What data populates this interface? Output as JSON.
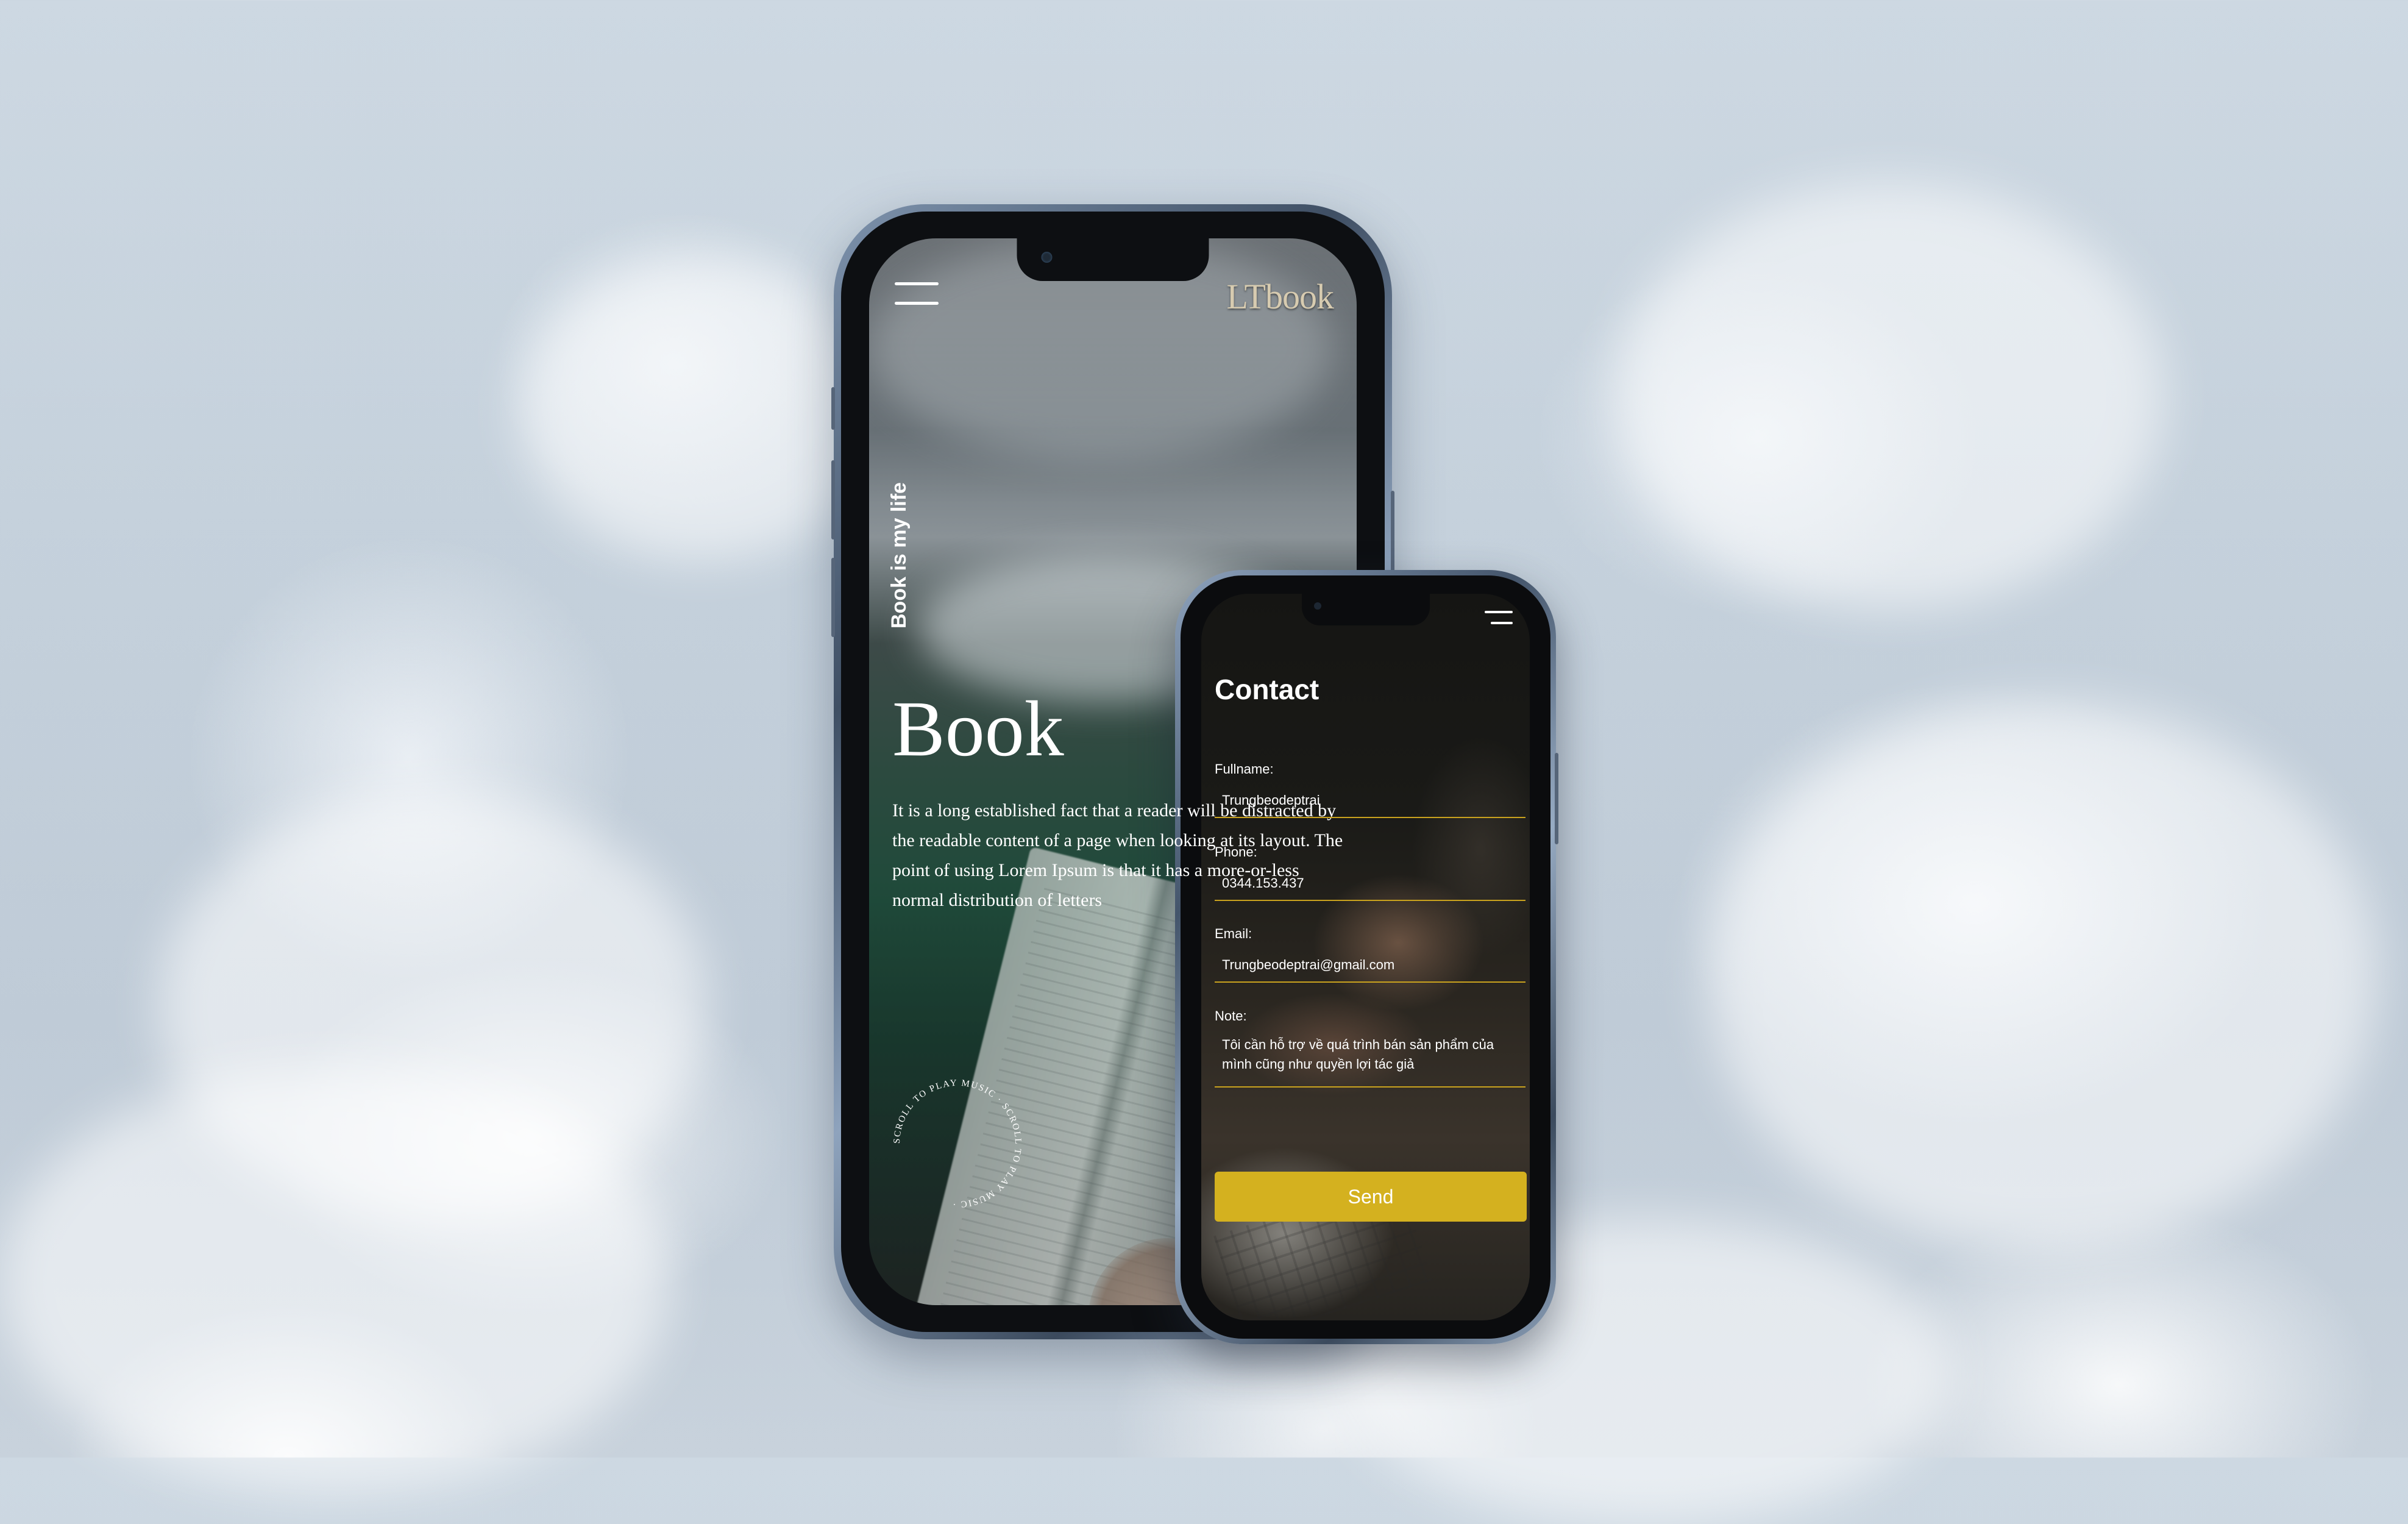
{
  "hero_phone": {
    "logo": "LTbook",
    "tagline": "Book is my life",
    "title": "Book",
    "body": "It is a long established fact that a reader will be distracted by the readable content of a page when looking at its layout. The point of using Lorem Ipsum is that it has a more-or-less normal distribution of letters",
    "scroll_badge": "SCROLL TO PLAY MUSIC · SCROLL TO PLAY MUSIC ·"
  },
  "contact_phone": {
    "title": "Contact",
    "fields": [
      {
        "label": "Fullname:",
        "value": "Trungbeodeptrai"
      },
      {
        "label": "Phone:",
        "value": "0344.153.437"
      },
      {
        "label": "Email:",
        "value": "Trungbeodeptrai@gmail.com"
      }
    ],
    "note": {
      "label": "Note:",
      "value": "Tôi cần hỗ trợ về quá trình bán sản phẩm của mình cũng như quyền lợi tác giả"
    },
    "send_label": "Send"
  },
  "colors": {
    "accent": "#d4b11f",
    "underline": "#c9a21e"
  }
}
